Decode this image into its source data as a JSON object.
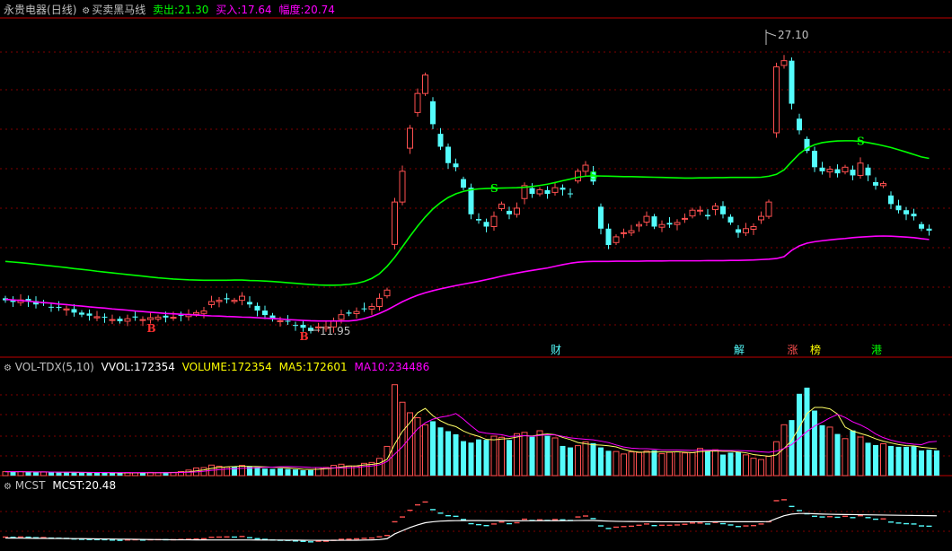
{
  "colors": {
    "up": "#ff5050",
    "down": "#54fcfc",
    "green": "#00ff00",
    "magenta": "#ff00ff",
    "white": "#ffffff",
    "yellow": "#ffff00",
    "grid": "#7f0000",
    "frame": "#c00000",
    "text": "#c0c0c0",
    "sell_signal": "#00ff00",
    "buy_signal": "#ff3030"
  },
  "main": {
    "symbol": "永贵电器",
    "period": "(日线)",
    "indicator": "买卖黑马线",
    "sell_label": "卖出:",
    "sell_value": "21.30",
    "buy_label": "买入:",
    "buy_value": "17.64",
    "range_label": "幅度:",
    "range_value": "20.74",
    "high_label": "27.10",
    "low_label": "11.95"
  },
  "event_tags": [
    {
      "text": "财",
      "color": "#54fcfc",
      "index": 72
    },
    {
      "text": "解",
      "color": "#54fcfc",
      "index": 96
    },
    {
      "text": "涨",
      "color": "#ff5050",
      "index": 103
    },
    {
      "text": "榜",
      "color": "#ffff00",
      "index": 106
    },
    {
      "text": "港",
      "color": "#00ff00",
      "index": 114
    }
  ],
  "signals": [
    {
      "text": "B",
      "type": "buy",
      "index": 19
    },
    {
      "text": "B",
      "type": "buy",
      "index": 39
    },
    {
      "text": "S",
      "type": "sell",
      "index": 64
    },
    {
      "text": "S",
      "type": "sell",
      "index": 77
    },
    {
      "text": "S",
      "type": "sell",
      "index": 112
    },
    {
      "text": "B",
      "type": "buy",
      "index": 128
    }
  ],
  "vol": {
    "name": "VOL-TDX(5,10)",
    "vvol_label": "VVOL:",
    "vvol_value": "172354",
    "volume_label": "VOLUME:",
    "volume_value": "172354",
    "ma5_label": "MA5:",
    "ma5_value": "172601",
    "ma10_label": "MA10:",
    "ma10_value": "234486"
  },
  "mcst": {
    "name": "MCST",
    "label": "MCST:",
    "value": "20.48"
  },
  "chart_data": [
    {
      "type": "candlestick",
      "title": "永贵电器(日线) 买卖黑马线",
      "ylim": [
        11.2,
        27.5
      ],
      "grid": true,
      "close": [
        13.8,
        13.72,
        13.82,
        13.76,
        13.6,
        13.65,
        13.48,
        13.44,
        13.38,
        13.2,
        13.1,
        13.05,
        13.0,
        12.98,
        12.86,
        12.78,
        12.9,
        12.96,
        12.86,
        12.95,
        12.98,
        12.96,
        12.97,
        13.05,
        13.12,
        13.2,
        13.28,
        13.74,
        13.8,
        13.85,
        13.8,
        14.0,
        13.6,
        13.3,
        13.08,
        12.88,
        12.8,
        12.76,
        12.59,
        12.46,
        12.3,
        12.5,
        12.5,
        12.8,
        13.1,
        13.15,
        13.25,
        13.4,
        13.5,
        13.9,
        14.3,
        18.6,
        20.1,
        22.2,
        23.9,
        24.8,
        22.4,
        21.3,
        20.5,
        20.3,
        19.3,
        18.0,
        17.7,
        17.4,
        17.9,
        18.5,
        18.0,
        18.3,
        19.4,
        19.0,
        19.2,
        19.0,
        19.3,
        19.2,
        19.0,
        20.1,
        20.4,
        19.6,
        17.3,
        16.5,
        16.9,
        17.1,
        17.2,
        17.5,
        17.9,
        17.4,
        17.5,
        17.5,
        17.6,
        17.8,
        18.2,
        18.2,
        17.9,
        18.4,
        18.0,
        17.6,
        17.1,
        17.3,
        17.4,
        17.9,
        18.6,
        25.2,
        25.5,
        23.4,
        22.1,
        21.1,
        20.3,
        20.1,
        20.2,
        20.0,
        20.3,
        19.9,
        20.5,
        19.9,
        19.4,
        19.5,
        18.5,
        18.2,
        18.0,
        17.9,
        17.3,
        17.2
      ],
      "series": [
        {
          "name": "卖出",
          "values": [
            15.7,
            15.67,
            15.64,
            15.6,
            15.56,
            15.52,
            15.48,
            15.44,
            15.4,
            15.35,
            15.31,
            15.27,
            15.22,
            15.18,
            15.14,
            15.1,
            15.06,
            15.02,
            14.98,
            14.94,
            14.9,
            14.87,
            14.84,
            14.82,
            14.8,
            14.79,
            14.78,
            14.78,
            14.78,
            14.78,
            14.79,
            14.79,
            14.77,
            14.76,
            14.74,
            14.72,
            14.69,
            14.66,
            14.63,
            14.6,
            14.57,
            14.55,
            14.54,
            14.54,
            14.55,
            14.58,
            14.63,
            14.72,
            14.87,
            15.1,
            15.46,
            15.9,
            16.41,
            16.93,
            17.42,
            17.87,
            18.26,
            18.57,
            18.82,
            19.0,
            19.12,
            19.2,
            19.24,
            19.26,
            19.27,
            19.28,
            19.29,
            19.3,
            19.32,
            19.36,
            19.41,
            19.47,
            19.55,
            19.64,
            19.72,
            19.81,
            19.86,
            19.88,
            19.87,
            19.86,
            19.85,
            19.84,
            19.84,
            19.83,
            19.82,
            19.81,
            19.8,
            19.79,
            19.78,
            19.77,
            19.77,
            19.78,
            19.78,
            19.79,
            19.79,
            19.8,
            19.8,
            19.8,
            19.8,
            19.81,
            19.86,
            19.95,
            20.17,
            20.57,
            20.95,
            21.23,
            21.4,
            21.5,
            21.55,
            21.58,
            21.59,
            21.59,
            21.56,
            21.5,
            21.43,
            21.35,
            21.26,
            21.15,
            21.04,
            20.92,
            20.8,
            20.73
          ],
          "color": "#00ff00"
        },
        {
          "name": "买入",
          "values": [
            13.85,
            13.82,
            13.79,
            13.76,
            13.72,
            13.69,
            13.66,
            13.62,
            13.59,
            13.55,
            13.52,
            13.48,
            13.45,
            13.42,
            13.38,
            13.35,
            13.32,
            13.28,
            13.25,
            13.22,
            13.19,
            13.16,
            13.14,
            13.12,
            13.1,
            13.08,
            13.06,
            13.04,
            13.03,
            13.01,
            13.0,
            12.98,
            12.97,
            12.95,
            12.93,
            12.91,
            12.89,
            12.86,
            12.84,
            12.82,
            12.8,
            12.79,
            12.79,
            12.79,
            12.79,
            12.79,
            12.83,
            12.91,
            13.02,
            13.16,
            13.33,
            13.53,
            13.73,
            13.9,
            14.05,
            14.17,
            14.27,
            14.36,
            14.44,
            14.52,
            14.59,
            14.66,
            14.73,
            14.81,
            14.89,
            14.98,
            15.06,
            15.13,
            15.2,
            15.26,
            15.32,
            15.38,
            15.46,
            15.54,
            15.61,
            15.66,
            15.69,
            15.7,
            15.7,
            15.7,
            15.71,
            15.71,
            15.71,
            15.71,
            15.72,
            15.72,
            15.72,
            15.73,
            15.73,
            15.73,
            15.73,
            15.73,
            15.74,
            15.74,
            15.74,
            15.75,
            15.75,
            15.76,
            15.77,
            15.79,
            15.81,
            15.84,
            15.93,
            16.24,
            16.46,
            16.59,
            16.66,
            16.71,
            16.75,
            16.79,
            16.82,
            16.86,
            16.89,
            16.91,
            16.93,
            16.94,
            16.93,
            16.91,
            16.89,
            16.86,
            16.81,
            16.77
          ],
          "color": "#ff00ff"
        }
      ]
    },
    {
      "type": "bar",
      "title": "VOL-TDX(5,10)",
      "ylim": [
        0,
        700000
      ],
      "values": [
        27000,
        26000,
        28000,
        24000,
        23000,
        25000,
        22000,
        21000,
        24000,
        21000,
        20000,
        19000,
        18000,
        20000,
        18000,
        17000,
        21000,
        19000,
        21000,
        22000,
        20000,
        23000,
        22000,
        28000,
        38000,
        52000,
        55000,
        72000,
        64000,
        58000,
        60000,
        70000,
        64000,
        58000,
        48000,
        46000,
        49000,
        45000,
        42000,
        37000,
        38000,
        55000,
        56000,
        70000,
        78000,
        66000,
        65000,
        84000,
        90000,
        118000,
        200000,
        622000,
        502000,
        430000,
        396000,
        348000,
        372000,
        330000,
        304000,
        283000,
        236000,
        226000,
        248000,
        245000,
        270000,
        262000,
        244000,
        287000,
        296000,
        266000,
        307000,
        273000,
        258000,
        203000,
        193000,
        205000,
        231000,
        222000,
        193000,
        170000,
        165000,
        148000,
        162000,
        158000,
        168000,
        173000,
        150000,
        160000,
        163000,
        155000,
        157000,
        186000,
        170000,
        177000,
        144000,
        157000,
        161000,
        142000,
        119000,
        110000,
        132000,
        232000,
        348000,
        380000,
        560000,
        602000,
        445000,
        345000,
        332000,
        285000,
        253000,
        309000,
        264000,
        225000,
        209000,
        218000,
        203000,
        197000,
        197000,
        201000,
        172000,
        177000,
        172354
      ],
      "series": [
        {
          "name": "MA5",
          "values": [
            27000,
            26500,
            27000,
            26250,
            25600,
            25200,
            24400,
            23000,
            23000,
            22600,
            21600,
            21000,
            20400,
            20400,
            19200,
            18400,
            18800,
            19000,
            19200,
            19600,
            20200,
            21000,
            21600,
            22800,
            26200,
            32600,
            39000,
            49000,
            56200,
            60200,
            61800,
            64800,
            63200,
            62000,
            60000,
            57200,
            55000,
            52000,
            48000,
            43800,
            42200,
            43400,
            47600,
            51200,
            59400,
            65000,
            67000,
            72600,
            76600,
            84600,
            111400,
            215600,
            302400,
            362400,
            430400,
            459600,
            409600,
            375200,
            350000,
            335600,
            305000,
            283800,
            268600,
            247600,
            245000,
            250200,
            253800,
            263600,
            273800,
            271000,
            279600,
            285800,
            280000,
            261400,
            246800,
            226400,
            218000,
            210800,
            208800,
            204200,
            196200,
            179600,
            167600,
            160600,
            160200,
            161800,
            162200,
            161800,
            163200,
            160200,
            157000,
            164200,
            166200,
            169000,
            166800,
            166800,
            161800,
            156200,
            144600,
            137800,
            132800,
            141000,
            186200,
            240400,
            330400,
            424400,
            467000,
            466400,
            456800,
            421800,
            332000,
            304800,
            288600,
            273200,
            252000,
            235600,
            223800,
            212400,
            204800,
            203200,
            194000,
            188800,
            183871
          ],
          "color": "#ffffff"
        },
        {
          "name": "MA10",
          "values": [
            27000,
            26500,
            27000,
            26250,
            25600,
            25200,
            24714,
            24125,
            24111,
            23800,
            23100,
            22400,
            21700,
            21400,
            20900,
            20600,
            20500,
            20300,
            20400,
            20300,
            19700,
            19900,
            20300,
            21300,
            22800,
            25700,
            29900,
            35800,
            40800,
            45000,
            47200,
            49700,
            51300,
            54200,
            57000,
            58400,
            60500,
            61800,
            60800,
            58900,
            56400,
            55500,
            53600,
            53300,
            53000,
            54000,
            56000,
            62000,
            66000,
            74000,
            96000,
            147000,
            197000,
            260000,
            320000,
            361000,
            386000,
            400000,
            408000,
            425000,
            386000,
            341000,
            300000,
            290000,
            285000,
            280000,
            268000,
            271000,
            273000,
            269000,
            275000,
            280000,
            279000,
            269000,
            259000,
            253000,
            249000,
            245000,
            236000,
            226000,
            210000,
            196000,
            188000,
            185000,
            184000,
            181000,
            176000,
            176000,
            176000,
            174000,
            173000,
            174000,
            175000,
            175000,
            173000,
            172000,
            172000,
            170000,
            167000,
            163000,
            160000,
            167000,
            186000,
            212000,
            257000,
            302000,
            339000,
            366000,
            395000,
            419000,
            398000,
            368000,
            347000,
            320000,
            285000,
            260000,
            243000,
            230000,
            221000,
            215000,
            212000,
            230000,
            234486
          ],
          "color": "#ff00ff"
        }
      ]
    },
    {
      "type": "line",
      "title": "MCST",
      "ylim": [
        10,
        28
      ],
      "series": [
        {
          "name": "MCST",
          "values": [
            13.5,
            13.48,
            13.46,
            13.44,
            13.42,
            13.4,
            13.38,
            13.36,
            13.34,
            13.32,
            13.3,
            13.27,
            13.24,
            13.21,
            13.18,
            13.15,
            13.12,
            13.09,
            13.06,
            13.03,
            13.0,
            12.98,
            12.96,
            12.94,
            12.93,
            12.92,
            12.91,
            12.9,
            12.9,
            12.9,
            12.9,
            12.9,
            12.9,
            12.89,
            12.88,
            12.87,
            12.86,
            12.85,
            12.84,
            12.82,
            12.8,
            12.79,
            12.78,
            12.78,
            12.79,
            12.8,
            12.82,
            12.86,
            12.92,
            13.0,
            13.3,
            14.8,
            15.8,
            16.8,
            17.6,
            18.3,
            18.6,
            18.8,
            18.9,
            18.95,
            18.97,
            18.97,
            18.96,
            18.94,
            18.93,
            18.92,
            18.9,
            18.9,
            18.91,
            18.91,
            18.92,
            18.92,
            18.93,
            18.94,
            18.95,
            18.98,
            19.01,
            19.0,
            18.9,
            18.8,
            18.74,
            18.7,
            18.68,
            18.66,
            18.64,
            18.62,
            18.6,
            18.59,
            18.58,
            18.58,
            18.59,
            18.6,
            18.6,
            18.61,
            18.61,
            18.61,
            18.61,
            18.61,
            18.61,
            18.62,
            18.66,
            19.6,
            20.5,
            21.0,
            21.2,
            21.2,
            21.1,
            21.0,
            20.95,
            20.9,
            20.87,
            20.84,
            20.81,
            20.78,
            20.74,
            20.7,
            20.67,
            20.64,
            20.6,
            20.57,
            20.54,
            20.51,
            20.48
          ],
          "color": "#ffffff"
        }
      ]
    }
  ]
}
